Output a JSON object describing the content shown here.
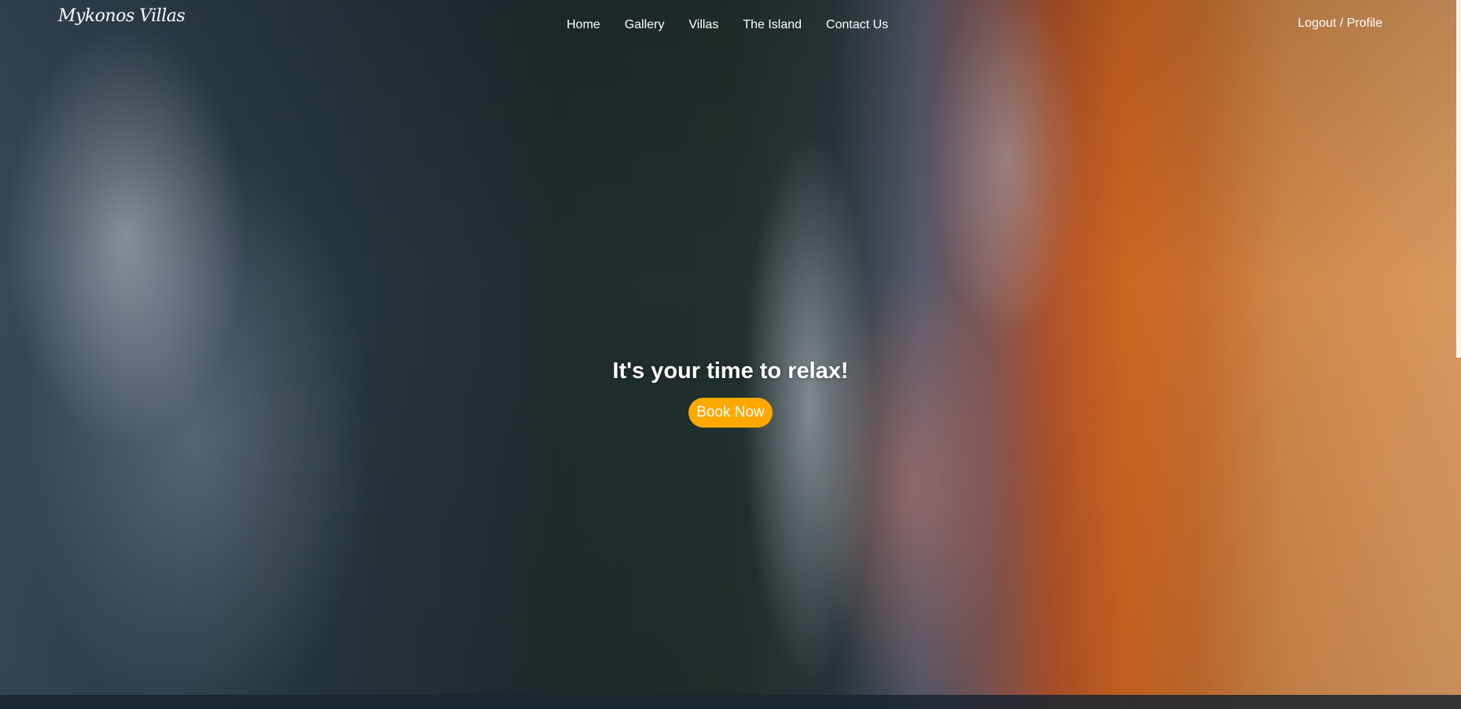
{
  "nav": {
    "logo": "Mykonos Villas",
    "links": [
      "Home",
      "Gallery",
      "Villas",
      "The Island",
      "Contact Us"
    ],
    "account": "Logout / Profile"
  },
  "hero": {
    "headline": "It's your time to relax!",
    "cta_label": "Book Now"
  },
  "colors": {
    "cta_background": "#ffa800",
    "text": "#ffffff"
  }
}
